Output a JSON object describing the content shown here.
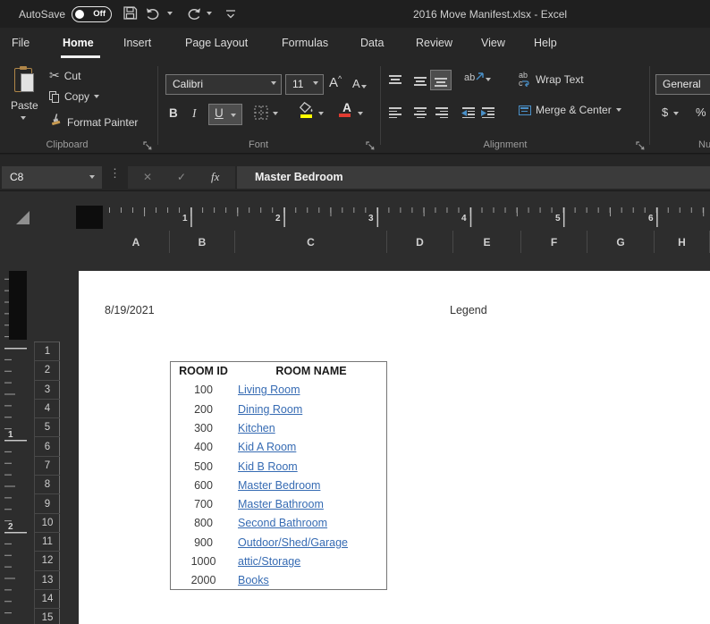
{
  "titlebar": {
    "autosave_label": "AutoSave",
    "autosave_state": "Off",
    "title": "2016 Move Manifest.xlsx  -  Excel"
  },
  "menu": {
    "tabs": [
      {
        "label": "File"
      },
      {
        "label": "Home"
      },
      {
        "label": "Insert"
      },
      {
        "label": "Page Layout"
      },
      {
        "label": "Formulas"
      },
      {
        "label": "Data"
      },
      {
        "label": "Review"
      },
      {
        "label": "View"
      },
      {
        "label": "Help"
      }
    ],
    "active_tab": "Home"
  },
  "ribbon": {
    "clipboard": {
      "group_label": "Clipboard",
      "paste_label": "Paste",
      "cut_label": "Cut",
      "copy_label": "Copy",
      "format_painter_label": "Format Painter"
    },
    "font": {
      "group_label": "Font",
      "font_name": "Calibri",
      "font_size": "11",
      "bold": "B",
      "italic": "I",
      "underline": "U"
    },
    "alignment": {
      "group_label": "Alignment",
      "wrap_text_label": "Wrap Text",
      "merge_center_label": "Merge & Center"
    },
    "number": {
      "group_label_partial": "Nu",
      "format_value": "General",
      "dollar": "$",
      "percent": "%"
    }
  },
  "formula_bar": {
    "name_box": "C8",
    "fx_label": "fx",
    "formula": "Master Bedroom"
  },
  "sheet": {
    "columns": [
      "A",
      "B",
      "C",
      "D",
      "E",
      "F",
      "G",
      "H"
    ],
    "rows": [
      "1",
      "2",
      "3",
      "4",
      "5",
      "6",
      "7",
      "8",
      "9",
      "10",
      "11",
      "12",
      "13",
      "14",
      "15"
    ],
    "hruler_numbers": [
      "1",
      "2",
      "3",
      "4",
      "5",
      "6"
    ],
    "vruler_numbers": [
      "1",
      "2"
    ],
    "page": {
      "header_left": "8/19/2021",
      "header_center": "Legend",
      "table": {
        "col1_header": "ROOM ID",
        "col2_header": "ROOM NAME",
        "rows": [
          {
            "id": "100",
            "name": "Living Room"
          },
          {
            "id": "200",
            "name": "Dining Room"
          },
          {
            "id": "300",
            "name": "Kitchen"
          },
          {
            "id": "400",
            "name": "Kid A Room"
          },
          {
            "id": "500",
            "name": "Kid B Room"
          },
          {
            "id": "600",
            "name": "Master Bedroom"
          },
          {
            "id": "700",
            "name": "Master Bathroom"
          },
          {
            "id": "800",
            "name": "Second Bathroom"
          },
          {
            "id": "900",
            "name": "Outdoor/Shed/Garage"
          },
          {
            "id": "1000",
            "name": "attic/Storage"
          },
          {
            "id": "2000",
            "name": "Books"
          }
        ]
      }
    }
  },
  "colors": {
    "hyperlink": "#366bb3",
    "fill_accent": "#ffff00",
    "font_color_accent": "#e03c31",
    "merge_icon_blue": "#4a90c8"
  }
}
